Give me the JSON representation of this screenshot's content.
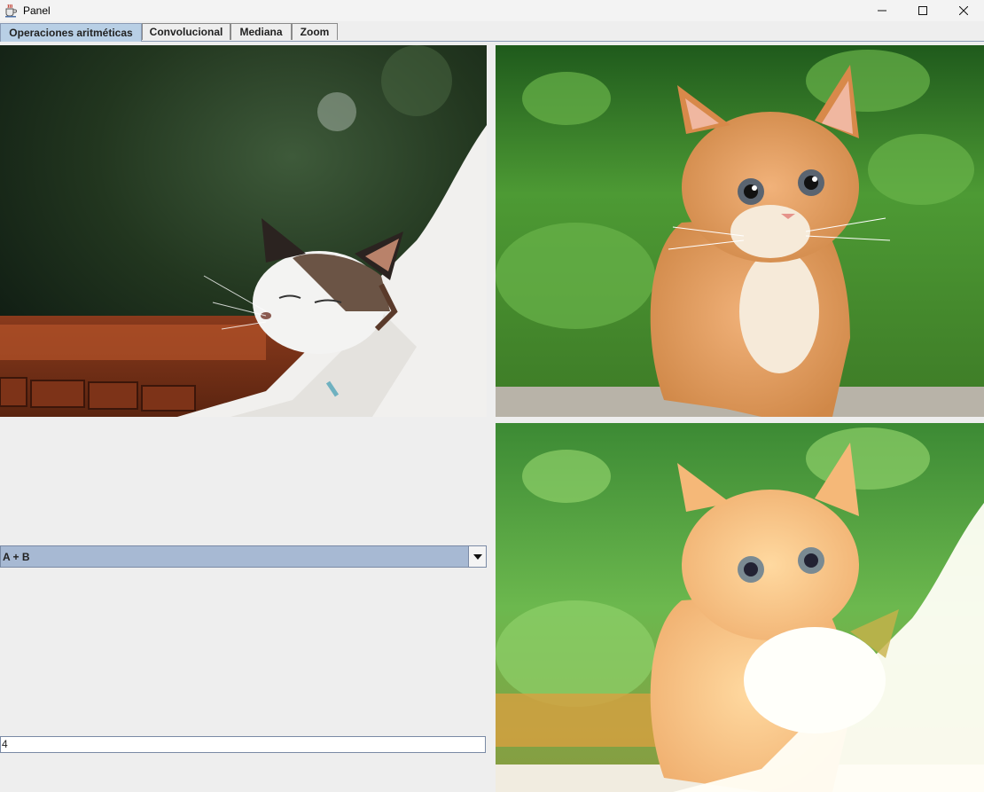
{
  "window": {
    "title": "Panel"
  },
  "tabs": [
    {
      "label": "Operaciones aritméticas",
      "active": true
    },
    {
      "label": "Convolucional",
      "active": false
    },
    {
      "label": "Mediana",
      "active": false
    },
    {
      "label": "Zoom",
      "active": false
    }
  ],
  "operation_select": {
    "selected": "A + B"
  },
  "value_field": {
    "value": "4"
  },
  "images": {
    "a": "stretching-white-cat-image",
    "b": "orange-kitten-on-grass-image",
    "result": "sum-result-image"
  },
  "icons": {
    "app": "java-cup-icon",
    "minimize": "minimize-icon",
    "maximize": "maximize-icon",
    "close": "close-icon",
    "dropdown": "chevron-down-icon"
  },
  "colors": {
    "active_tab": "#b8cfe5",
    "combo_bg": "#a7b9d3",
    "window_bg": "#eeeeee"
  }
}
